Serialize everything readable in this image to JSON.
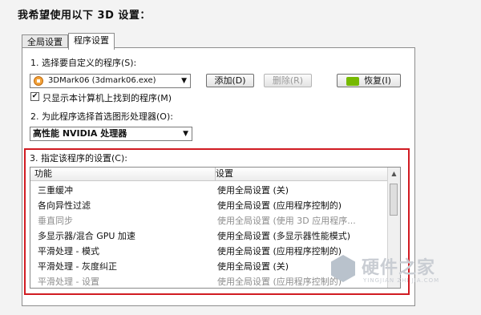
{
  "heading": "我希望使用以下 3D 设置：",
  "tabs": [
    {
      "label": "全局设置",
      "active": false
    },
    {
      "label": "程序设置",
      "active": true
    }
  ],
  "step1": {
    "label": "1. 选择要自定义的程序(S):",
    "program_value": "3DMark06 (3dmark06.exe)",
    "add_label": "添加(D)",
    "delete_label": "删除(R)",
    "restore_label": "恢复(I)",
    "checkbox_label": "只显示本计算机上找到的程序(M)",
    "checkbox_checked": true
  },
  "step2": {
    "label": "2. 为此程序选择首选图形处理器(O):",
    "value": "高性能 NVIDIA 处理器"
  },
  "step3": {
    "label": "3. 指定该程序的设置(C):",
    "col_feature": "功能",
    "col_setting": "设置",
    "rows": [
      {
        "feature": "三重缓冲",
        "setting": "使用全局设置 (关)"
      },
      {
        "feature": "各向异性过滤",
        "setting": "使用全局设置 (应用程序控制的)"
      },
      {
        "feature": "垂直同步",
        "setting": "使用全局设置 (使用 3D 应用程序..."
      },
      {
        "feature": "多显示器/混合 GPU 加速",
        "setting": "使用全局设置 (多显示器性能模式)"
      },
      {
        "feature": "平滑处理 - 模式",
        "setting": "使用全局设置 (应用程序控制的)"
      },
      {
        "feature": "平滑处理 - 灰度纠正",
        "setting": "使用全局设置 (关)"
      },
      {
        "feature": "平滑处理 - 设置",
        "setting": "使用全局设置 (应用程序控制的)"
      }
    ]
  },
  "watermark": {
    "text": "硬件之家",
    "sub": "YINGJIAN ZHI JIA.COM"
  },
  "colors": {
    "highlight_border": "#d11b22",
    "nvidia_green": "#76b900"
  }
}
